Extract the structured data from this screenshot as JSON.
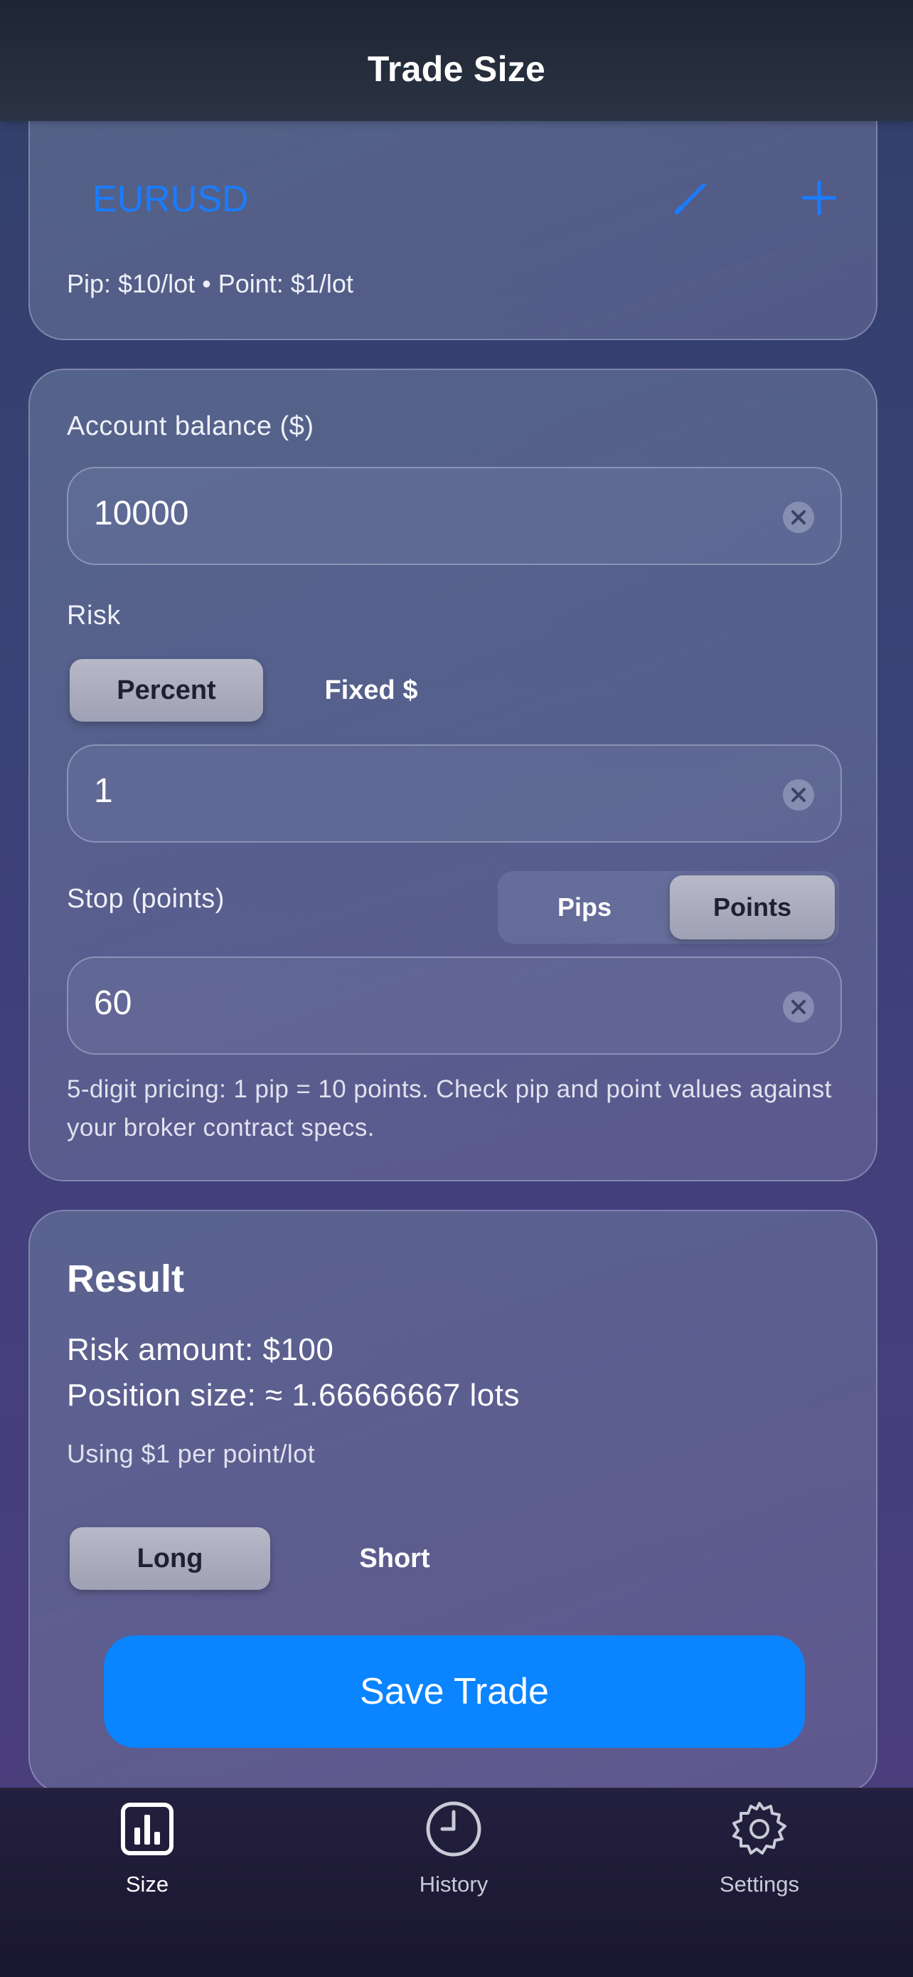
{
  "header": {
    "title": "Trade Size"
  },
  "symbol": {
    "name": "EURUSD",
    "meta": "Pip: $10/lot • Point: $1/lot",
    "edit_icon": "pencil-icon",
    "add_icon": "plus-icon"
  },
  "inputs": {
    "balance_label": "Account balance ($)",
    "balance_value": "10000",
    "risk_label": "Risk",
    "risk_modes": [
      "Percent",
      "Fixed $"
    ],
    "risk_mode_selected": "Percent",
    "risk_value": "1",
    "stop_label": "Stop (points)",
    "stop_units": [
      "Pips",
      "Points"
    ],
    "stop_unit_selected": "Points",
    "stop_value": "60",
    "hint": "5-digit pricing: 1 pip = 10 points. Check pip and point values against your broker contract specs."
  },
  "result": {
    "title": "Result",
    "risk_amount": "Risk amount: $100",
    "position_size": "Position size: ≈ 1.66666667 lots",
    "note": "Using $1 per point/lot",
    "directions": [
      "Long",
      "Short"
    ],
    "direction_selected": "Long",
    "save_label": "Save Trade"
  },
  "tabs": [
    {
      "label": "Size",
      "icon": "bar-chart-icon",
      "active": true
    },
    {
      "label": "History",
      "icon": "clock-icon",
      "active": false
    },
    {
      "label": "Settings",
      "icon": "gear-icon",
      "active": false
    }
  ],
  "colors": {
    "accent": "#0a84ff",
    "symbol": "#1a7cff"
  }
}
